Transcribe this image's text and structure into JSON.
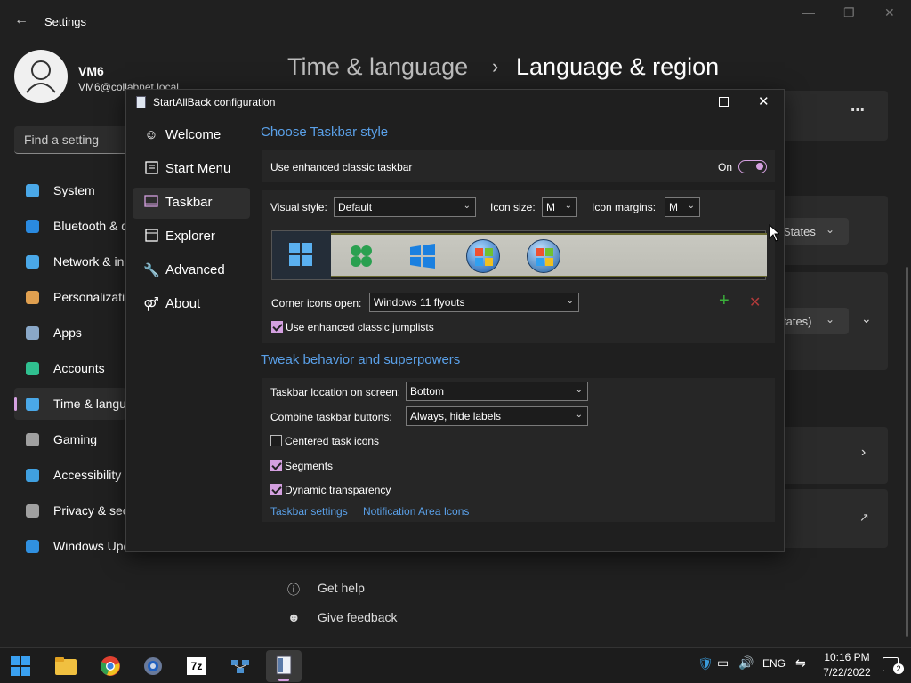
{
  "settings": {
    "title": "Settings",
    "user": {
      "name": "VM6",
      "email": "VM6@collabnet.local"
    },
    "search_placeholder": "Find a setting",
    "nav": [
      {
        "label": "System",
        "color": "#4aa8e8"
      },
      {
        "label": "Bluetooth & d",
        "color": "#2a8ae0"
      },
      {
        "label": "Network & in",
        "color": "#4aa8e8"
      },
      {
        "label": "Personalizatio",
        "color": "#e0a050"
      },
      {
        "label": "Apps",
        "color": "#8aa8c8"
      },
      {
        "label": "Accounts",
        "color": "#30c090"
      },
      {
        "label": "Time & langu",
        "color": "#4aa8e8"
      },
      {
        "label": "Gaming",
        "color": "#a0a0a0"
      },
      {
        "label": "Accessibility",
        "color": "#40a0e0"
      },
      {
        "label": "Privacy & sec",
        "color": "#a0a0a0"
      },
      {
        "label": "Windows Upd",
        "color": "#3090e0"
      }
    ],
    "breadcrumb": {
      "parent": "Time & language",
      "current": "Language & region"
    },
    "right_partial": {
      "states1": "States",
      "states2": "tates)"
    },
    "help": {
      "get_help": "Get help",
      "give_feedback": "Give feedback"
    }
  },
  "dialog": {
    "title": "StartAllBack configuration",
    "nav": [
      "Welcome",
      "Start Menu",
      "Taskbar",
      "Explorer",
      "Advanced",
      "About"
    ],
    "section1": "Choose Taskbar style",
    "enhanced_label": "Use enhanced classic taskbar",
    "toggle_state": "On",
    "visual_style_label": "Visual style:",
    "visual_style_value": "Default",
    "icon_size_label": "Icon size:",
    "icon_size_value": "M",
    "icon_margins_label": "Icon margins:",
    "icon_margins_value": "M",
    "corner_label": "Corner icons open:",
    "corner_value": "Windows 11 flyouts",
    "jumplists_label": "Use enhanced classic jumplists",
    "add_symbol": "+",
    "remove_symbol": "✕",
    "section2": "Tweak behavior and superpowers",
    "location_label": "Taskbar location on screen:",
    "location_value": "Bottom",
    "combine_label": "Combine taskbar buttons:",
    "combine_value": "Always, hide labels",
    "centered_label": "Centered task icons",
    "segments_label": "Segments",
    "dynamic_label": "Dynamic transparency",
    "link1": "Taskbar settings",
    "link2": "Notification Area Icons"
  },
  "taskbar": {
    "lang": "ENG",
    "time": "10:16 PM",
    "date": "7/22/2022",
    "notifications": "2",
    "apps": [
      "start-icon",
      "file-explorer-icon",
      "chrome-icon",
      "settings-icon",
      "7zip-icon",
      "network-app-icon",
      "startallback-icon"
    ]
  }
}
